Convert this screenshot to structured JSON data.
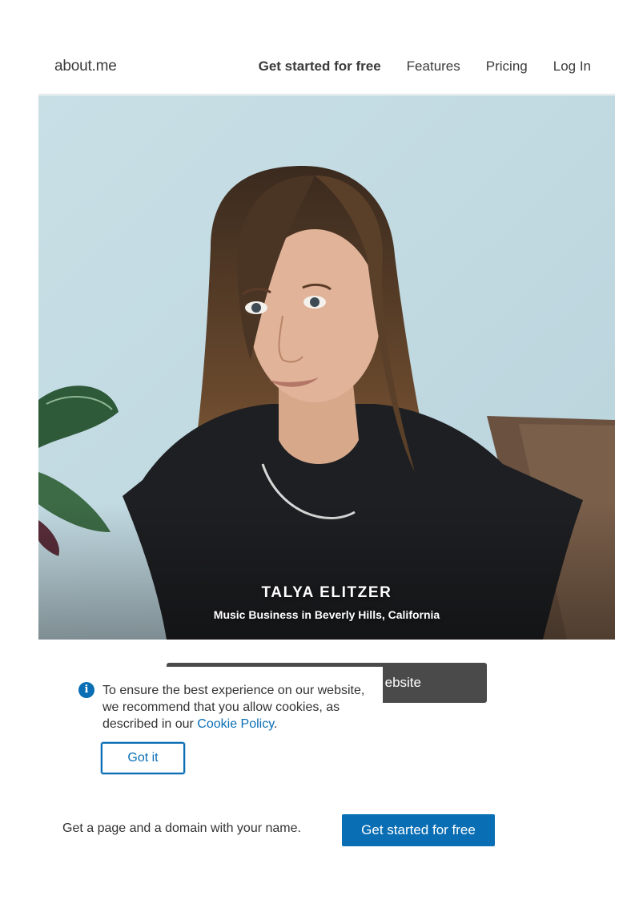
{
  "header": {
    "logo": "about.me",
    "nav": {
      "get_started": "Get started for free",
      "features": "Features",
      "pricing": "Pricing",
      "login": "Log In"
    }
  },
  "hero": {
    "name": "TALYA ELITZER",
    "subtitle": "Music Business in Beverly Hills, California"
  },
  "website_button": {
    "visible_label": "ebsite"
  },
  "cookie_notice": {
    "text_before_link": "To ensure the best experience on our website, we recommend that you allow cookies, as described in our ",
    "link_text": "Cookie Policy",
    "text_after_link": ".",
    "button": "Got it",
    "icon": "info-icon"
  },
  "footer": {
    "text": "Get a page and a domain with your name.",
    "cta": "Get started for free"
  },
  "colors": {
    "accent_blue": "#0a6eb4",
    "dark_button": "#4a4a4a",
    "hero_background": "#c7dde4"
  }
}
